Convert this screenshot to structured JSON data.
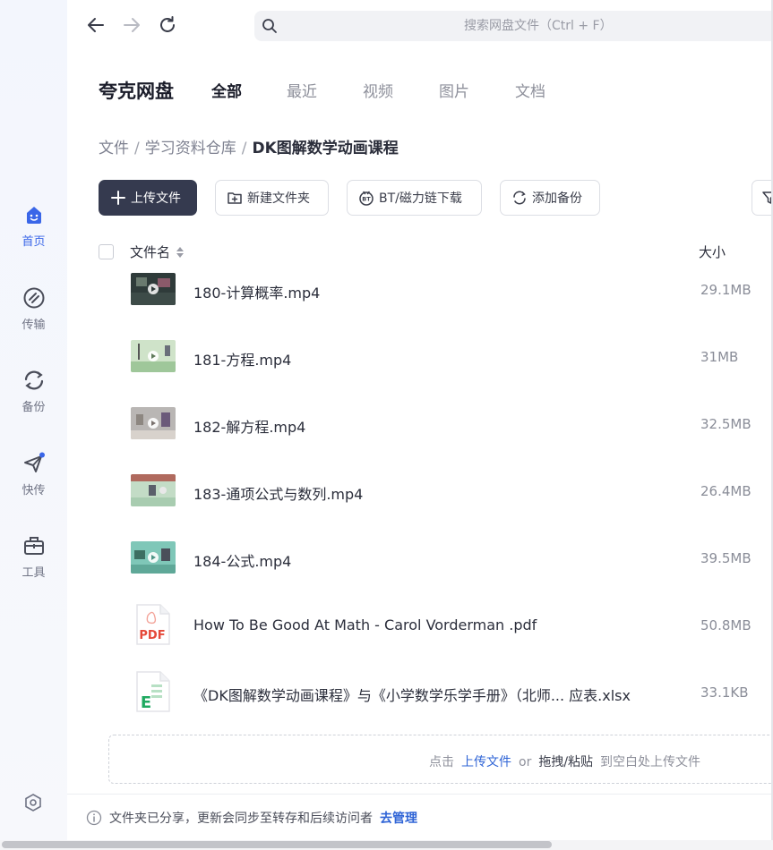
{
  "rail": {
    "items": [
      {
        "label": "首页",
        "icon": "home-smile-icon",
        "active": true
      },
      {
        "label": "传输",
        "icon": "transfer-icon",
        "active": false
      },
      {
        "label": "备份",
        "icon": "backup-icon",
        "active": false
      },
      {
        "label": "快传",
        "icon": "quick-send-icon",
        "active": false
      },
      {
        "label": "工具",
        "icon": "toolbox-icon",
        "active": false
      }
    ],
    "settings_icon": "settings-hex-icon"
  },
  "search": {
    "placeholder": "搜索网盘文件（Ctrl + F）"
  },
  "header": {
    "brand": "夸克网盘",
    "tabs": [
      "全部",
      "最近",
      "视频",
      "图片",
      "文档"
    ],
    "active_tab": 0
  },
  "breadcrumb": [
    "文件",
    "学习资料仓库",
    "DK图解数学动画课程"
  ],
  "toolbar": {
    "upload": "上传文件",
    "new_folder": "新建文件夹",
    "bt_download": "BT/磁力链下载",
    "add_backup": "添加备份"
  },
  "table": {
    "col_name": "文件名",
    "col_size": "大小",
    "rows": [
      {
        "name": "180-计算概率.mp4",
        "size": "29.1MB",
        "type": "video",
        "bg": "#2f3b3a"
      },
      {
        "name": "181-方程.mp4",
        "size": "31MB",
        "type": "video",
        "bg": "#cfe3c9"
      },
      {
        "name": "182-解方程.mp4",
        "size": "32.5MB",
        "type": "video",
        "bg": "#b9b6b4"
      },
      {
        "name": "183-通项公式与数列.mp4",
        "size": "26.4MB",
        "type": "video",
        "bg": "#c3dcc6"
      },
      {
        "name": "184-公式.mp4",
        "size": "39.5MB",
        "type": "video",
        "bg": "#7fc7b8"
      },
      {
        "name": "How To Be Good At Math - Carol Vorderman .pdf",
        "size": "50.8MB",
        "type": "pdf"
      },
      {
        "name": "《DK图解数学动画课程》与《小学数学乐学手册》（北师...  应表.xlsx",
        "size": "33.1KB",
        "type": "xlsx"
      }
    ]
  },
  "dropzone": {
    "prefix": "点击",
    "upload_link": "上传文件",
    "or": "or",
    "drag": "拖拽/粘贴",
    "suffix": "到空白处上传文件"
  },
  "footer": {
    "text": "文件夹已分享，更新会同步至转存和后续访问者",
    "link": "去管理"
  },
  "colors": {
    "accent": "#3a66e8",
    "primary_button": "#353a4f",
    "link": "#2f64d6"
  }
}
